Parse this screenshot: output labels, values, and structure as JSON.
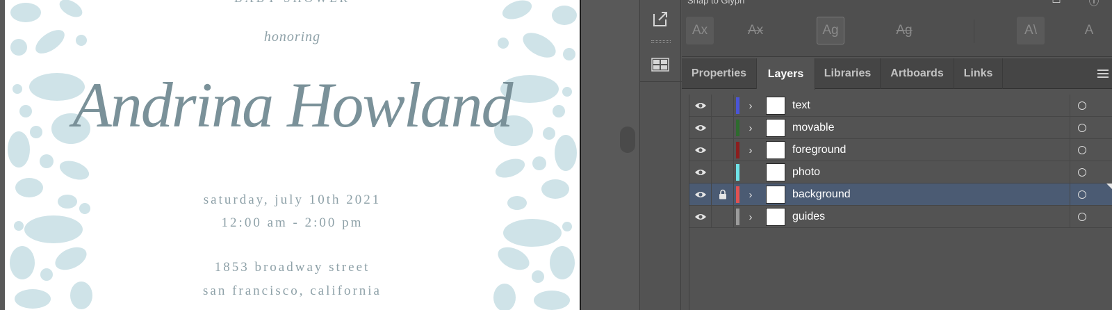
{
  "invitation": {
    "header": "BABY SHOWER",
    "honoring": "honoring",
    "name": "Andrina Howland",
    "date": "saturday, july 10th 2021",
    "time": "12:00 am - 2:00 pm",
    "street": "1853 broadway street",
    "city": "san francisco, california",
    "text_color": "#8ea1a8",
    "floral_color": "#cfe3e8"
  },
  "snap_panel": {
    "title": "Snap to Glyph",
    "icons": [
      "Ax",
      "Ax",
      "Ag",
      "Ag",
      "A\\",
      "A"
    ]
  },
  "panel_tabs": [
    {
      "label": "Properties",
      "active": false
    },
    {
      "label": "Layers",
      "active": true
    },
    {
      "label": "Libraries",
      "active": false
    },
    {
      "label": "Artboards",
      "active": false
    },
    {
      "label": "Links",
      "active": false
    }
  ],
  "layers": [
    {
      "name": "text",
      "color": "#4a55d6",
      "locked": false,
      "has_children": true,
      "selected": false
    },
    {
      "name": "movable",
      "color": "#2e6b2e",
      "locked": false,
      "has_children": true,
      "selected": false
    },
    {
      "name": "foreground",
      "color": "#8b1e1e",
      "locked": false,
      "has_children": true,
      "selected": false
    },
    {
      "name": "photo",
      "color": "#6fe3e8",
      "locked": false,
      "has_children": false,
      "selected": false
    },
    {
      "name": "background",
      "color": "#e05252",
      "locked": true,
      "has_children": true,
      "selected": true
    },
    {
      "name": "guides",
      "color": "#9b9b9b",
      "locked": false,
      "has_children": true,
      "selected": false
    }
  ],
  "icons": {
    "export": "export-icon",
    "artboards": "artboards-grid-icon",
    "visibility": "eye-icon",
    "lock": "lock-icon",
    "expand": "chevron-right-icon",
    "target": "target-circle-icon",
    "menu": "hamburger-menu-icon"
  }
}
